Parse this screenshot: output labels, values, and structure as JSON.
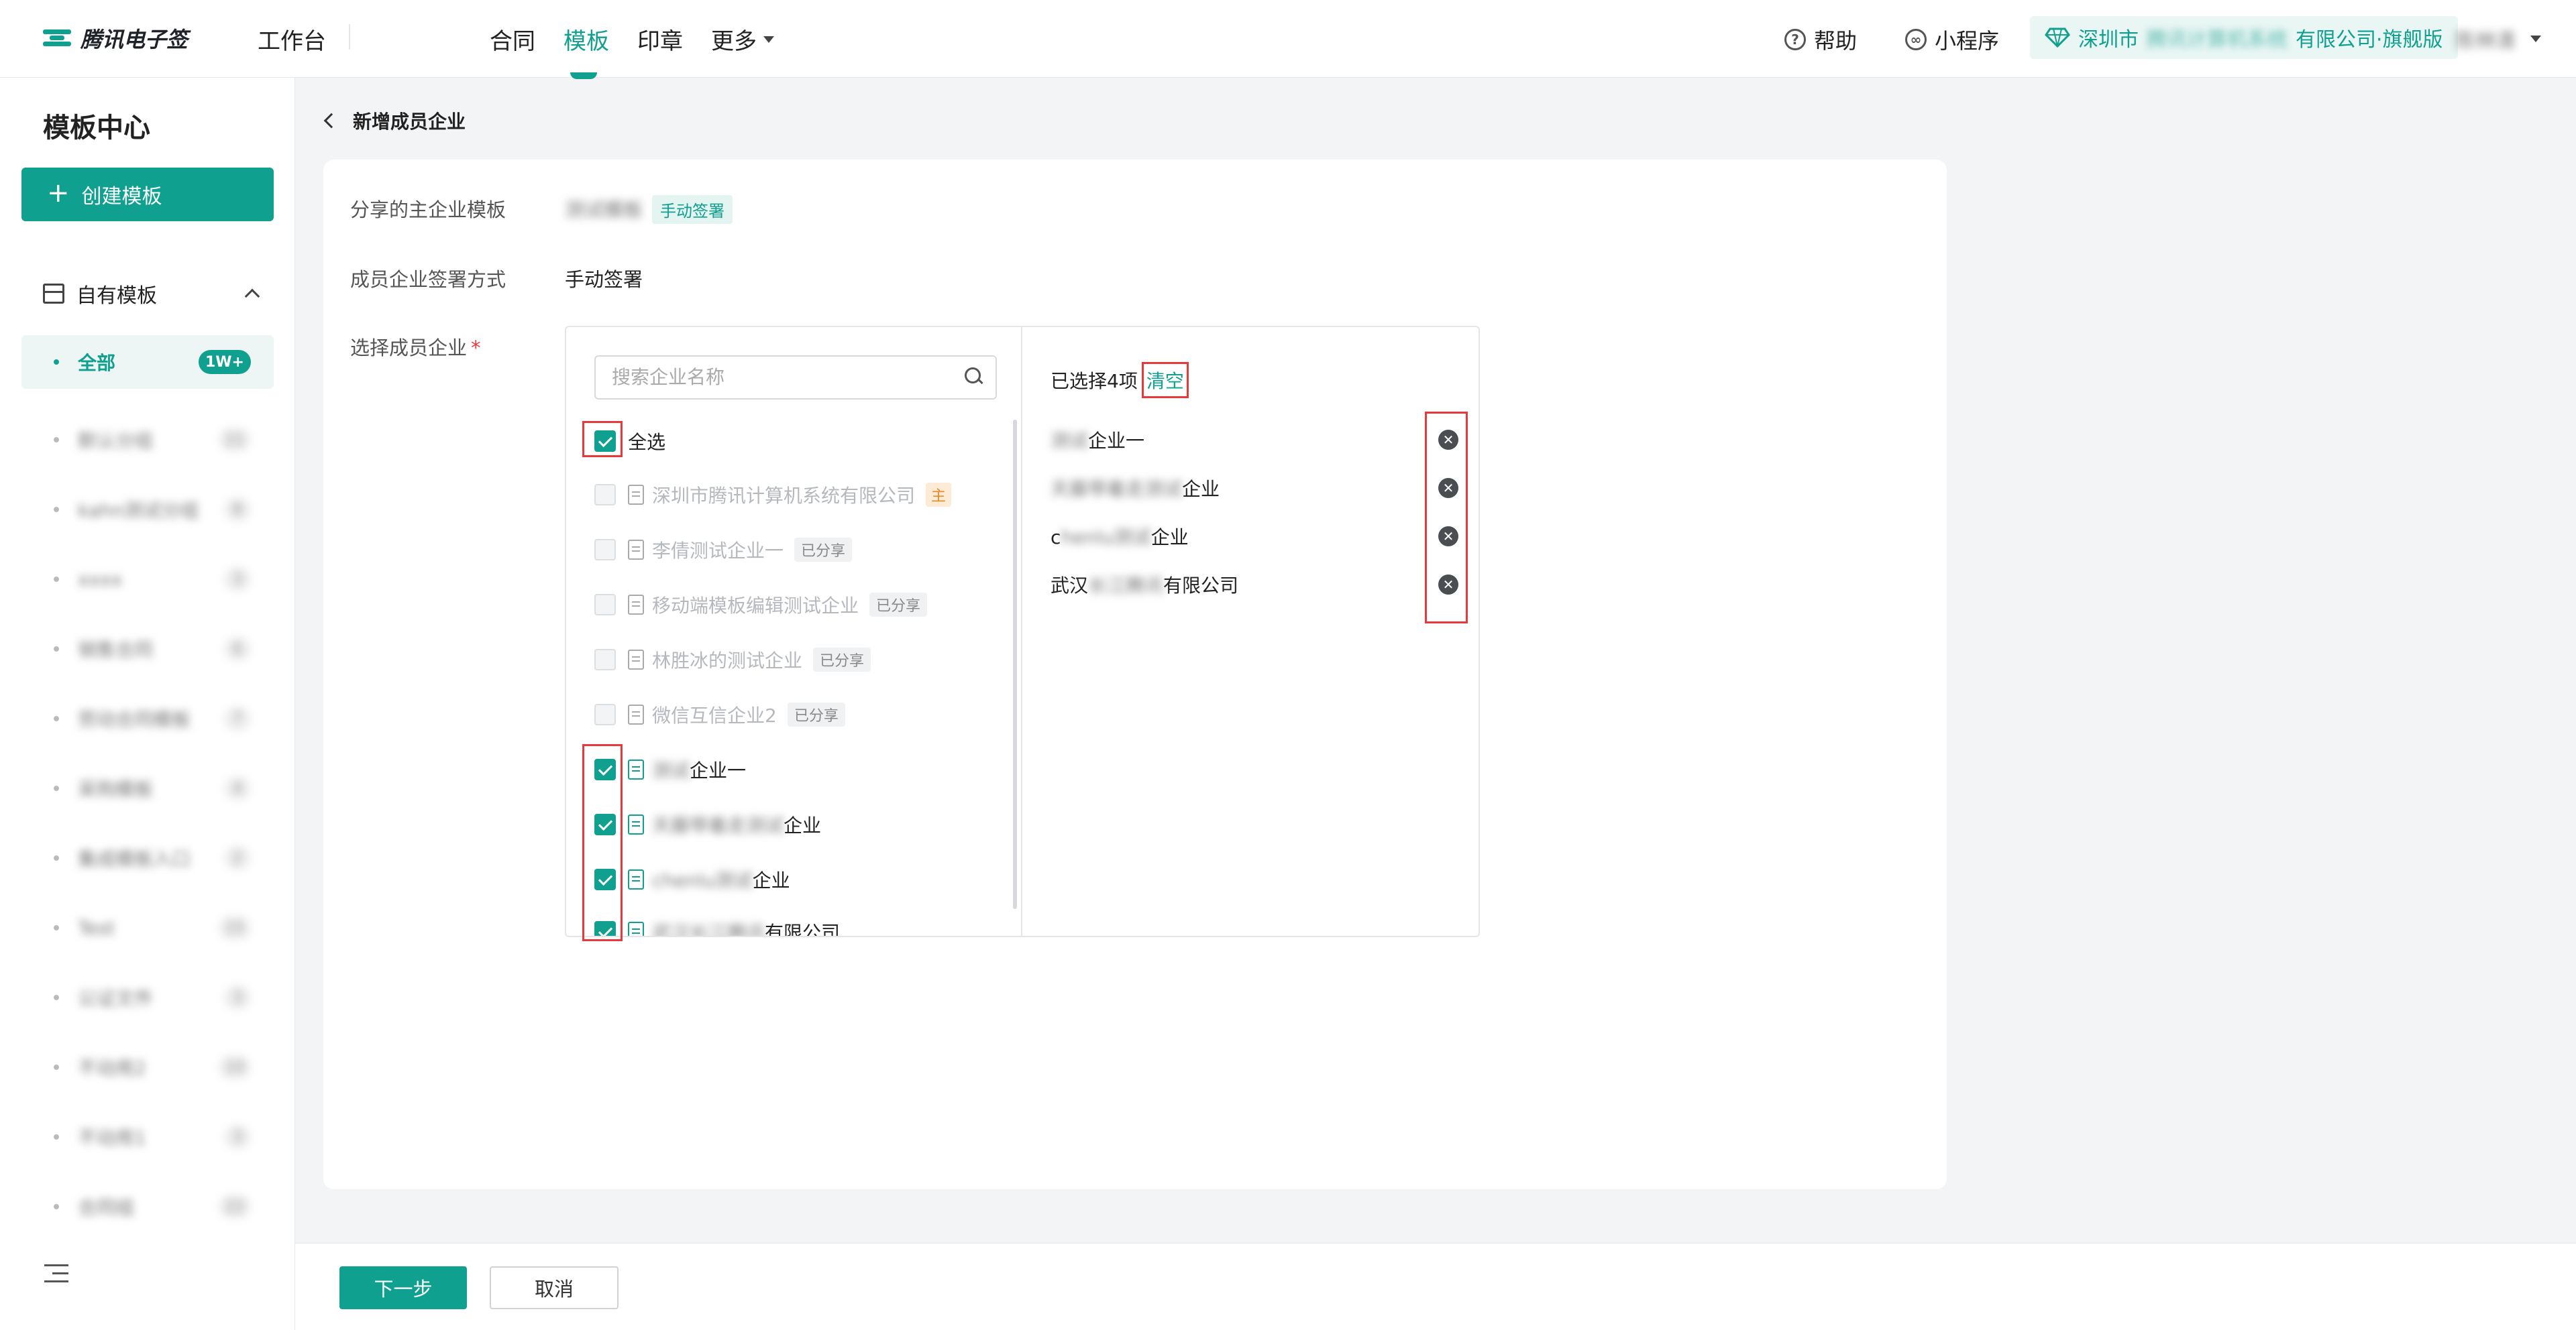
{
  "header": {
    "logo_text": "腾讯电子签",
    "workbench": "工作台",
    "nav": [
      "合同",
      "模板",
      "印章",
      "更多"
    ],
    "help": "帮助",
    "mini_program": "小程序",
    "company_prefix": "深圳市",
    "company_masked": "腾讯计算机系统",
    "company_suffix": "有限公司·旗舰版",
    "user_name": "陈林清"
  },
  "sidebar": {
    "title": "模板中心",
    "create_label": "创建模板",
    "section_label": "自有模板",
    "items": [
      {
        "label": "全部",
        "count": "1W+"
      },
      {
        "label": "默认分组",
        "count": "21"
      },
      {
        "label": "kahn测试分组",
        "count": "8"
      },
      {
        "label": "xxxx",
        "count": "3"
      },
      {
        "label": "销售合同",
        "count": "6"
      },
      {
        "label": "劳动合同模板",
        "count": "7"
      },
      {
        "label": "采购模板",
        "count": "4"
      },
      {
        "label": "集成模板入口",
        "count": "2"
      },
      {
        "label": "Test",
        "count": "15"
      },
      {
        "label": "公证文件",
        "count": "3"
      },
      {
        "label": "不动用2",
        "count": "10"
      },
      {
        "label": "不动用1",
        "count": "3"
      },
      {
        "label": "合同组",
        "count": "22"
      }
    ]
  },
  "page": {
    "back_title": "新增成员企业",
    "shared_template_label": "分享的主企业模板",
    "shared_template_name": "测试模板",
    "shared_template_tag": "手动签署",
    "sign_method_label": "成员企业签署方式",
    "sign_method_value": "手动签署",
    "select_label": "选择成员企业",
    "required_mark": "*"
  },
  "selector": {
    "search_placeholder": "搜索企业名称",
    "select_all": "全选",
    "options": [
      {
        "name": "深圳市腾讯计算机系统有限公司",
        "badge": "主"
      },
      {
        "name": "李倩测试企业一",
        "badge": "已分享"
      },
      {
        "name": "移动端模板编辑测试企业",
        "badge": "已分享"
      },
      {
        "name": "林胜冰的测试企业",
        "badge": "已分享"
      },
      {
        "name": "微信互信企业2",
        "badge": "已分享"
      },
      {
        "masked": "测试",
        "suffix": "企业一"
      },
      {
        "masked": "天藤带着走测试",
        "suffix": "企业"
      },
      {
        "masked": "chenlu测试",
        "suffix": "企业"
      },
      {
        "masked": "武汉长江腾讯",
        "suffix": "有限公司"
      }
    ],
    "selected_head": "已选择4项",
    "clear_label": "清空",
    "selected": [
      {
        "prefix": "",
        "masked": "测试",
        "suffix": "企业一"
      },
      {
        "prefix": "",
        "masked": "天藤带着走测试",
        "suffix": "企业"
      },
      {
        "prefix": "c",
        "masked": "henlu测试",
        "suffix": "企业"
      },
      {
        "prefix": "武汉",
        "masked": "长江腾讯",
        "suffix": "有限公司"
      }
    ]
  },
  "footer": {
    "next_label": "下一步",
    "cancel_label": "取消"
  },
  "colors": {
    "accent": "#10a08f",
    "highlight": "#e5393b"
  }
}
